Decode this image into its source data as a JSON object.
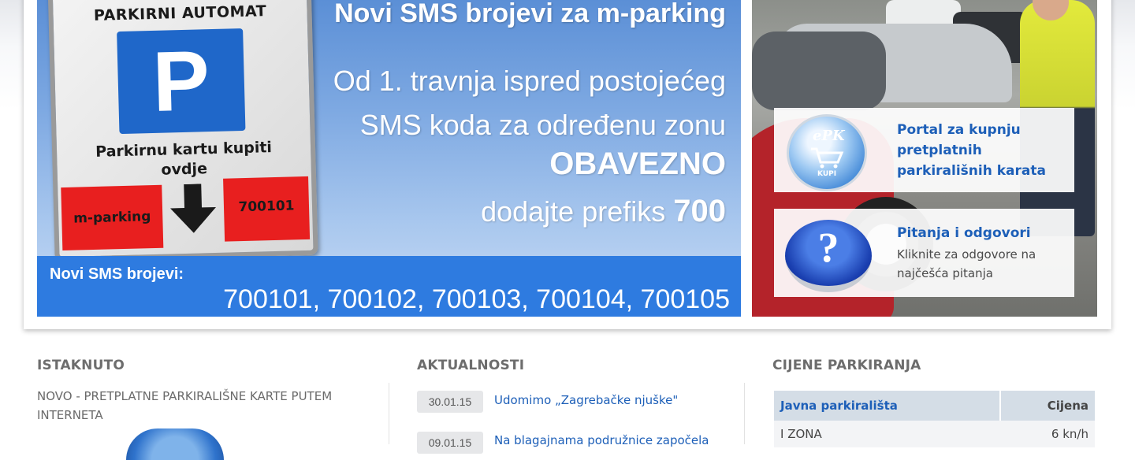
{
  "banner": {
    "headline": "Novi SMS brojevi za m-parking",
    "sign": {
      "title": "PARKIRNI AUTOMAT",
      "p_letter": "P",
      "text_line1": "Parkirnu kartu kupiti",
      "text_line2": "ovdje",
      "left_label": "m-parking",
      "right_label": "700101"
    },
    "line1": "Od 1. travnja ispred postojećeg",
    "line2": "SMS koda za određenu zonu",
    "line3": "OBAVEZNO",
    "line4_prefix": "dodajte prefiks ",
    "line4_number": "700",
    "sms_label": "Novi SMS brojevi:",
    "sms_numbers": "700101, 700102, 700103, 700104, 700105"
  },
  "promos": {
    "epk": {
      "icon_text": "ePK",
      "icon_sub": "KUPI",
      "title_line1": "Portal za kupnju",
      "title_line2": "pretplatnih",
      "title_line3": "parkirališnih karata"
    },
    "faq": {
      "icon_glyph": "?",
      "title": "Pitanja i odgovori",
      "desc_line1": "Kliknite za odgovore na",
      "desc_line2": "najčešća pitanja"
    }
  },
  "featured": {
    "heading": "ISTAKNUTO",
    "article_title": "NOVO - PRETPLATNE PARKIRALIŠNE KARTE PUTEM INTERNETA"
  },
  "news": {
    "heading": "AKTUALNOSTI",
    "items": [
      {
        "date": "30.01.15",
        "title": "Udomimo „Zagrebačke njuške\""
      },
      {
        "date": "09.01.15",
        "title": "Na blagajnama podružnice započela"
      }
    ]
  },
  "prices": {
    "heading": "CIJENE PARKIRANJA",
    "col_name": "Javna parkirališta",
    "col_price": "Cijena",
    "rows": [
      {
        "zone": "I ZONA",
        "price": "6 kn/h"
      }
    ]
  },
  "colors": {
    "link_blue": "#1d5fb8",
    "sms_bar": "#2e7be0",
    "sign_red": "#e81f1f",
    "heading_grey": "#6d6d6d"
  }
}
